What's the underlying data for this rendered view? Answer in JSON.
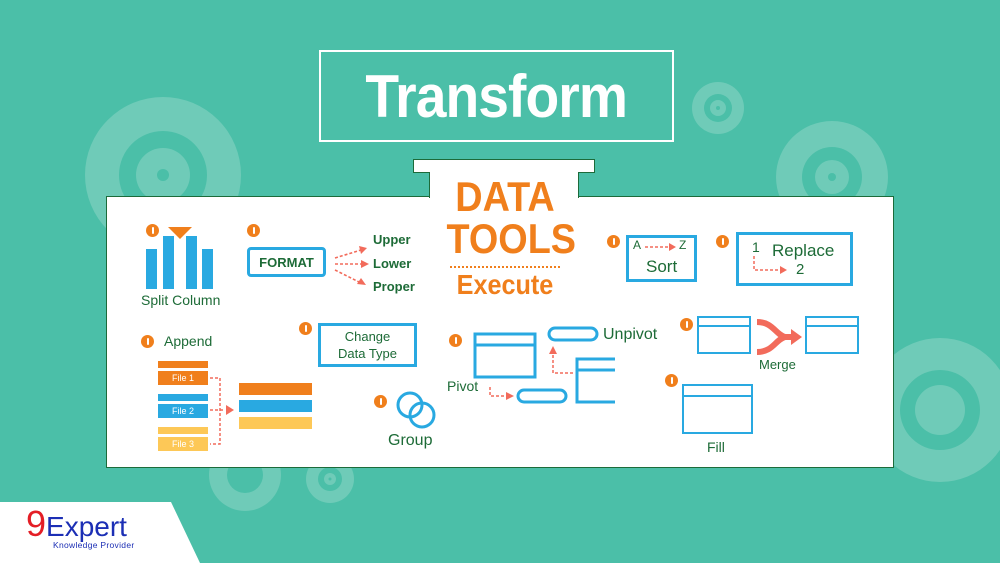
{
  "title": "Transform",
  "center": {
    "line1": "DATA",
    "line2": "TOOLS",
    "line3": "Execute"
  },
  "tools": {
    "split_column": {
      "label": "Split Column"
    },
    "format": {
      "box_label": "FORMAT",
      "options": [
        "Upper",
        "Lower",
        "Proper"
      ]
    },
    "sort": {
      "from": "A",
      "to": "Z",
      "label": "Sort"
    },
    "replace": {
      "from": "1",
      "label": "Replace",
      "to": "2"
    },
    "append": {
      "label": "Append",
      "files": [
        "File 1",
        "File 2",
        "File 3"
      ]
    },
    "change_type": {
      "line1": "Change",
      "line2": "Data Type"
    },
    "pivot": {
      "pivot_label": "Pivot",
      "unpivot_label": "Unpivot"
    },
    "group": {
      "label": "Group"
    },
    "merge": {
      "label": "Merge"
    },
    "fill": {
      "label": "Fill"
    }
  },
  "logo": {
    "brand_digit": "9",
    "brand_name": "Expert",
    "tagline": "Knowledge Provider"
  },
  "colors": {
    "background": "#4bbfa8",
    "accent_orange": "#f07f1c",
    "accent_blue": "#29a9e1",
    "text_green": "#1d6b37",
    "arrow_red": "#f26b5b",
    "file_yellow": "#fdc857"
  }
}
